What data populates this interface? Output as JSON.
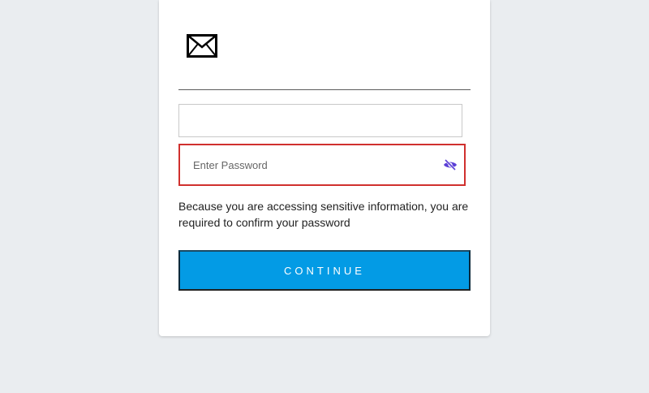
{
  "login": {
    "email_value": "",
    "password_placeholder": "Enter Password",
    "password_value": "",
    "help_text": "Because you are accessing sensitive information, you are required to confirm your password",
    "continue_label": "CONTINUE"
  },
  "icons": {
    "logo": "envelope-icon",
    "password_toggle": "eye-slash-icon"
  },
  "colors": {
    "background": "#eaedf0",
    "card": "#ffffff",
    "error_border": "#d0302e",
    "primary_button": "#039be5",
    "toggle_icon": "#5b3fd6"
  }
}
